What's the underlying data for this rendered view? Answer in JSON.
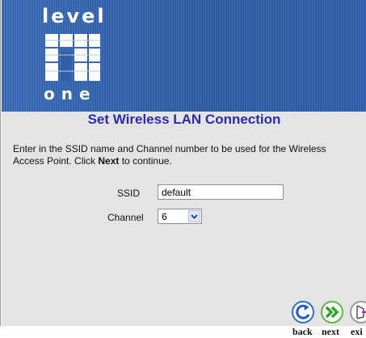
{
  "brand": {
    "logo_top": "level",
    "logo_bottom": "one"
  },
  "page": {
    "title": "Set Wireless LAN Connection",
    "instruction_part1": "Enter in the SSID name and Channel number to be used for the Wireless Access Point. Click ",
    "instruction_bold": "Next",
    "instruction_part2": " to continue."
  },
  "form": {
    "ssid_label": "SSID",
    "ssid_value": "default",
    "channel_label": "Channel",
    "channel_value": "6"
  },
  "nav": {
    "back_label": "back",
    "next_label": "next",
    "exit_label": "exi"
  },
  "colors": {
    "banner": "#2f5fa6",
    "title": "#2a2ab8",
    "content_bg": "#e4e4e4"
  }
}
